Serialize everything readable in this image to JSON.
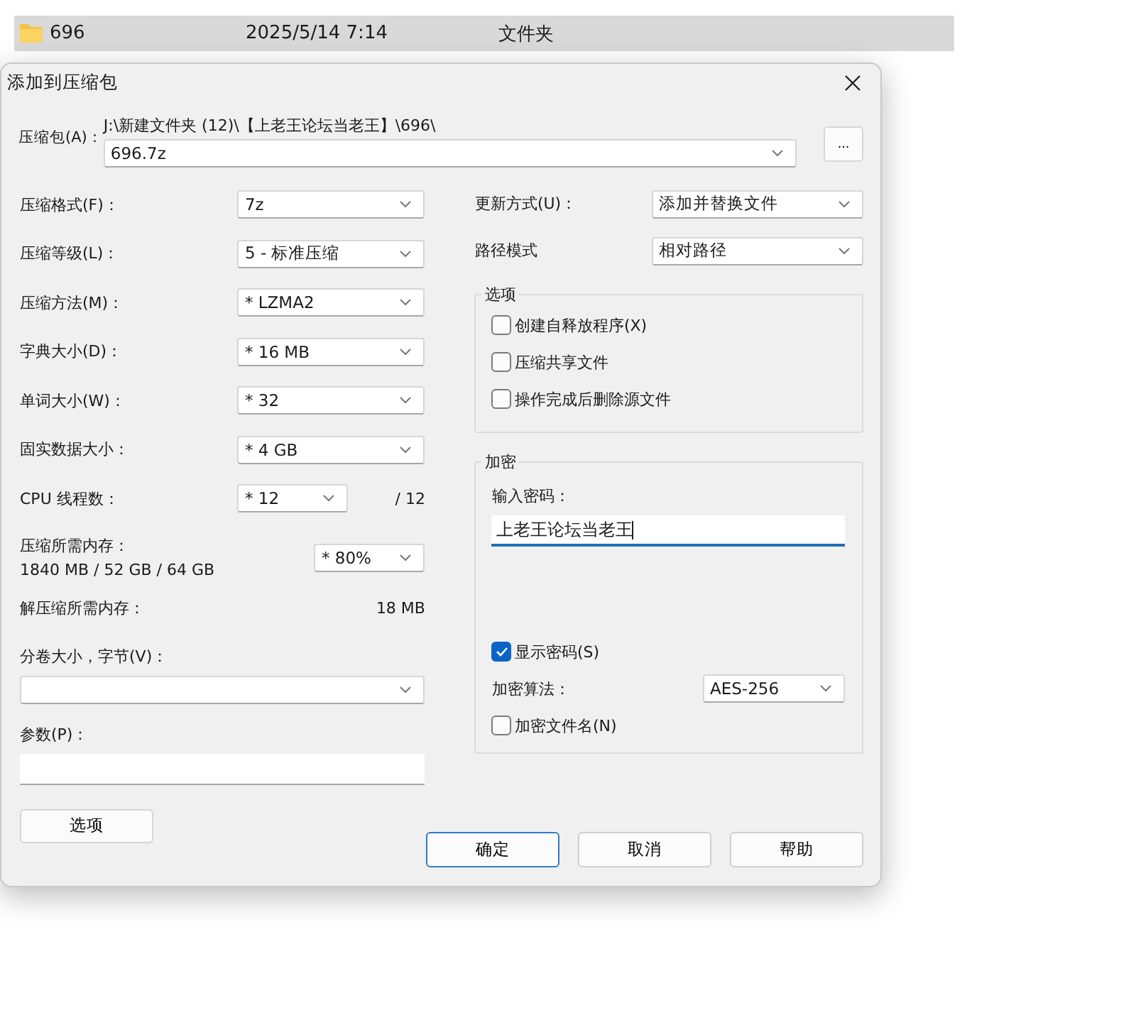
{
  "file_row": {
    "name": "696",
    "date": "2025/5/14 7:14",
    "type": "文件夹",
    "selected": true
  },
  "dialog": {
    "title": "添加到压缩包",
    "archive": {
      "label": "压缩包(A)：",
      "path": "J:\\新建文件夹 (12)\\【上老王论坛当老王】\\696\\",
      "value": "696.7z",
      "browse": "..."
    },
    "left_fields": [
      {
        "kind": "select",
        "label": "压缩格式(F)：",
        "value": "7z"
      },
      {
        "kind": "select",
        "label": "压缩等级(L)：",
        "value": "5 - 标准压缩"
      },
      {
        "kind": "select",
        "label": "压缩方法(M)：",
        "value": "* LZMA2"
      },
      {
        "kind": "select",
        "label": "字典大小(D)：",
        "value": "* 16 MB"
      },
      {
        "kind": "select",
        "label": "单词大小(W)：",
        "value": "* 32"
      },
      {
        "kind": "select",
        "label": "固实数据大小：",
        "value": "* 4 GB"
      },
      {
        "kind": "threads",
        "label": "CPU 线程数：",
        "value": "* 12",
        "total": "/ 12"
      },
      {
        "kind": "memory",
        "label": "压缩所需内存：",
        "detail": "1840 MB / 52 GB / 64 GB",
        "value": "* 80%"
      },
      {
        "kind": "info",
        "label": "解压缩所需内存：",
        "value": "18 MB"
      }
    ],
    "volume": {
      "label": "分卷大小，字节(V)："
    },
    "params": {
      "label": "参数(P)："
    },
    "options_button": "选项",
    "right_fields": [
      {
        "label": "更新方式(U)：",
        "value": "添加并替换文件"
      },
      {
        "label": "路径模式",
        "value": "相对路径"
      }
    ],
    "options_group": {
      "title": "选项",
      "items": [
        {
          "label": "创建自释放程序(X)",
          "checked": false
        },
        {
          "label": "压缩共享文件",
          "checked": false
        },
        {
          "label": "操作完成后删除源文件",
          "checked": false
        }
      ]
    },
    "encryption": {
      "title": "加密",
      "password_label": "输入密码：",
      "password": "上老王论坛当老王",
      "show_password": {
        "label": "显示密码(S)",
        "checked": true
      },
      "method_label": "加密算法：",
      "method": "AES-256",
      "encrypt_names": {
        "label": "加密文件名(N)",
        "checked": false
      }
    },
    "buttons": [
      {
        "label": "确定",
        "default": true
      },
      {
        "label": "取消",
        "default": false
      },
      {
        "label": "帮助",
        "default": false
      }
    ]
  }
}
